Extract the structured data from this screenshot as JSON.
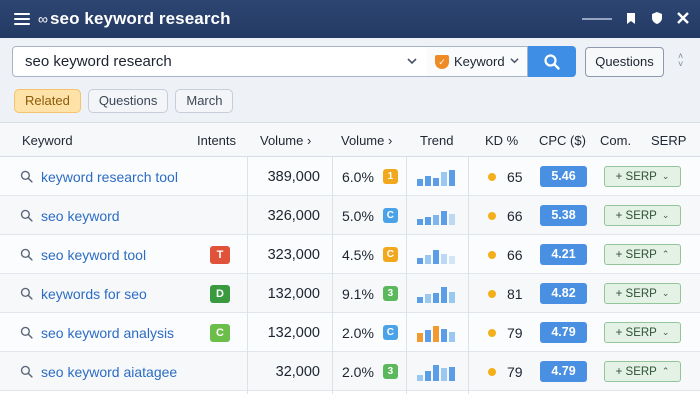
{
  "window": {
    "title": "seo keyword research",
    "logo_icon": "link-icon"
  },
  "search": {
    "value": "seo keyword research",
    "type_label": "Keyword",
    "questions_label": "Questions"
  },
  "chips": [
    {
      "label": "Related",
      "active": true
    },
    {
      "label": "Questions",
      "active": false
    },
    {
      "label": "March",
      "active": false
    }
  ],
  "table": {
    "headers": {
      "keyword": "Keyword",
      "intents": "Intents",
      "volume": "Volume",
      "volume2": "Volume",
      "sort_arrow": "›",
      "trend": "Trend",
      "kd": "KD %",
      "cpc": "CPC ($)",
      "com": "Com.",
      "serp": "SERP"
    },
    "rows": [
      {
        "keyword": "keyword research tool",
        "intent": "",
        "intent_color": "",
        "volume": "389,000",
        "pct": "6.0%",
        "score": "1",
        "score_color": "#f2a81d",
        "trend_colors": [
          "#5b9de6",
          "#5b9de6",
          "#5b9de6",
          "#9ac8f0",
          "#5b9de6"
        ],
        "trend_heights": [
          0.45,
          0.6,
          0.5,
          0.85,
          1.0
        ],
        "kd": "65",
        "cpc": "5.46",
        "serp_label": "+ SERP",
        "serp_chevron": "⌄"
      },
      {
        "keyword": "seo keyword",
        "intent": "",
        "intent_color": "",
        "volume": "326,000",
        "pct": "5.0%",
        "score": "C",
        "score_color": "#4aa3e8",
        "trend_colors": [
          "#5b9de6",
          "#5b9de6",
          "#7fb4ec",
          "#5b9de6",
          "#bcd9f4"
        ],
        "trend_heights": [
          0.35,
          0.5,
          0.65,
          0.9,
          0.7
        ],
        "kd": "66",
        "cpc": "5.38",
        "serp_label": "+ SERP",
        "serp_chevron": "⌄"
      },
      {
        "keyword": "seo keyword tool",
        "intent": "T",
        "intent_color": "#e0523a",
        "volume": "323,000",
        "pct": "4.5%",
        "score": "C",
        "score_color": "#f2a81d",
        "trend_colors": [
          "#5b9de6",
          "#9ac8f0",
          "#5b9de6",
          "#bcd9f4",
          "#d3e5f6"
        ],
        "trend_heights": [
          0.4,
          0.55,
          0.9,
          0.6,
          0.5
        ],
        "kd": "66",
        "cpc": "4.21",
        "serp_label": "+ SERP",
        "serp_chevron": "⌃"
      },
      {
        "keyword": "keywords for seo",
        "intent": "D",
        "intent_color": "#3a9a3f",
        "volume": "132,000",
        "pct": "9.1%",
        "score": "3",
        "score_color": "#5cb85c",
        "trend_colors": [
          "#5b9de6",
          "#9ac8f0",
          "#5b9de6",
          "#5b9de6",
          "#9ac8f0"
        ],
        "trend_heights": [
          0.35,
          0.55,
          0.6,
          1.0,
          0.7
        ],
        "kd": "81",
        "cpc": "4.82",
        "serp_label": "+ SERP",
        "serp_chevron": "⌄"
      },
      {
        "keyword": "seo keyword analysis",
        "intent": "C",
        "intent_color": "#6cbe4a",
        "volume": "132,000",
        "pct": "2.0%",
        "score": "C",
        "score_color": "#4aa3e8",
        "trend_colors": [
          "#f29a2e",
          "#5b9de6",
          "#f29a2e",
          "#5b9de6",
          "#9ac8f0"
        ],
        "trend_heights": [
          0.55,
          0.75,
          1.0,
          0.8,
          0.6
        ],
        "kd": "79",
        "cpc": "4.79",
        "serp_label": "+ SERP",
        "serp_chevron": "⌄"
      },
      {
        "keyword": "seo keyword aiatagee",
        "intent": "",
        "intent_color": "",
        "volume": "32,000",
        "pct": "2.0%",
        "score": "3",
        "score_color": "#5cb85c",
        "trend_colors": [
          "#9ac8f0",
          "#5b9de6",
          "#5b9de6",
          "#9ac8f0",
          "#5b9de6"
        ],
        "trend_heights": [
          0.35,
          0.6,
          1.0,
          0.8,
          0.9
        ],
        "kd": "79",
        "cpc": "4.79",
        "serp_label": "+ SERP",
        "serp_chevron": "⌃"
      }
    ]
  },
  "colors": {
    "titlebar": "#2d4572",
    "accent": "#3e8ee6",
    "link": "#2b6cc4",
    "kd_dot": "#f3b01b",
    "cpc_badge": "#4a90e2"
  }
}
